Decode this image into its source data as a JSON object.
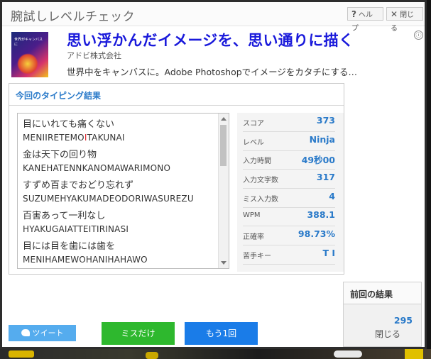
{
  "header": {
    "title": "腕試しレベルチェック",
    "help_label": "ヘルプ",
    "help_icon": "?",
    "close_label": "閉じる",
    "close_icon": "✕"
  },
  "ad": {
    "thumb_text": "世界がキャンバスに",
    "title": "思い浮かんだイメージを、思い通りに描く",
    "company": "アドビ株式会社",
    "description": "世界中をキャンバスに。Adobe Photoshopでイメージをカタチにする…",
    "info_icon": "ⓘ"
  },
  "result": {
    "heading": "今回のタイピング結果",
    "phrases": [
      {
        "jp": "目にいれても痛くない",
        "ro_pre": "MENIIRETEMO",
        "ro_miss": "I",
        "ro_post": "TAKUNAI"
      },
      {
        "jp": "金は天下の回り物",
        "ro_pre": "KANEHATENNKANOMAWARIMONO",
        "ro_miss": "",
        "ro_post": ""
      },
      {
        "jp": "すずめ百までおどり忘れず",
        "ro_pre": "SUZUMEHYAKUMADEODORIWASUREZU",
        "ro_miss": "",
        "ro_post": ""
      },
      {
        "jp": "百害あって一利なし",
        "ro_pre": "HYAKUGAIATTEITIRINASI",
        "ro_miss": "",
        "ro_post": ""
      },
      {
        "jp": "目には目を歯には歯を",
        "ro_pre": "MENIHAMEWOHANIHAHAWO",
        "ro_miss": "",
        "ro_post": ""
      }
    ],
    "stats": [
      {
        "label": "スコア",
        "value": "373"
      },
      {
        "label": "レベル",
        "value": "Ninja"
      },
      {
        "label": "入力時間",
        "value": "49秒00"
      },
      {
        "label": "入力文字数",
        "value": "317"
      },
      {
        "label": "ミス入力数",
        "value": "4"
      },
      {
        "label": "WPM",
        "value": "388.1"
      },
      {
        "label": "正確率",
        "value": "98.73%"
      },
      {
        "label": "苦手キー",
        "value": "T I"
      }
    ]
  },
  "previous": {
    "heading": "前回の結果",
    "score": "295",
    "close_label": "閉じる"
  },
  "buttons": {
    "tweet": "ツイート",
    "miss_only": "ミスだけ",
    "retry": "もう1回"
  },
  "colors": {
    "accent": "#2a7ac9",
    "miss": "#e0242d",
    "twitter": "#55acee",
    "green": "#2eb82e",
    "blue": "#1a7ce8"
  }
}
